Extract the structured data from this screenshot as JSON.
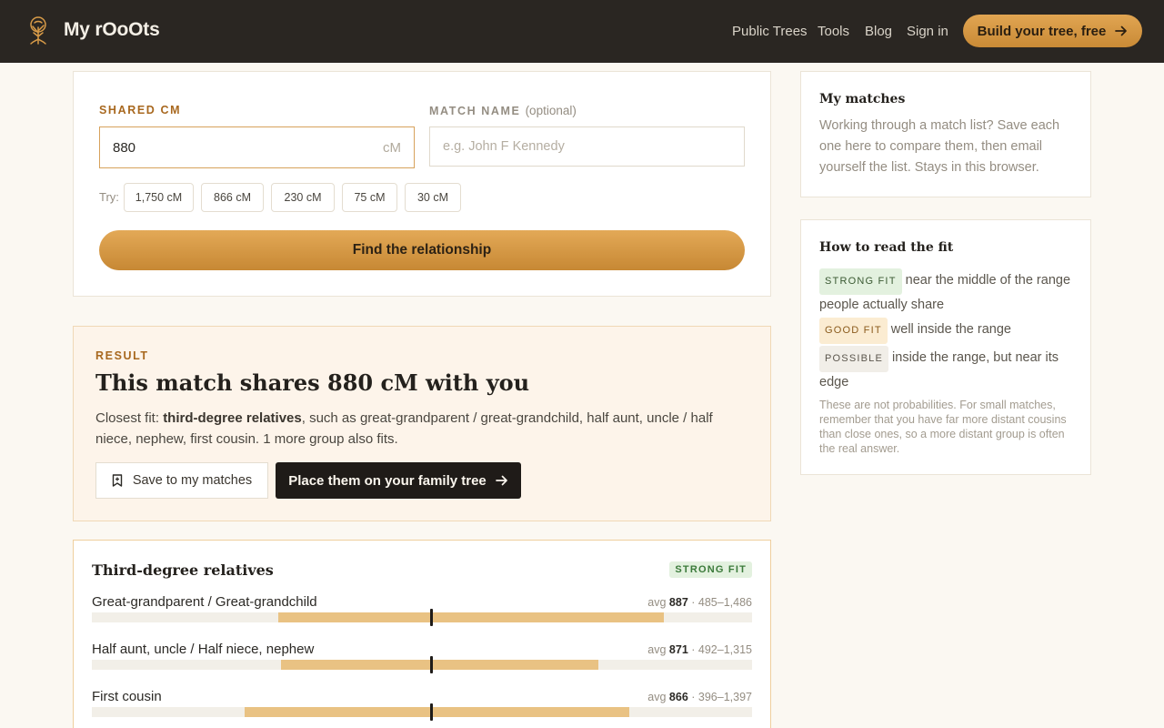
{
  "header": {
    "brand": "My rOoOts",
    "nav": [
      "Public Trees",
      "Tools",
      "Blog",
      "Sign in"
    ],
    "cta": "Build your tree, free"
  },
  "form": {
    "shared_cm_label": "SHARED CM",
    "shared_cm_value": "880",
    "unit": "cM",
    "match_name_label": "MATCH NAME",
    "match_name_optional": "(optional)",
    "match_name_placeholder": "e.g. John F Kennedy",
    "try_label": "Try:",
    "try_chips": [
      "1,750 cM",
      "866 cM",
      "230 cM",
      "75 cM",
      "30 cM"
    ],
    "submit": "Find the relationship"
  },
  "result": {
    "label": "RESULT",
    "headline": "This match shares 880 cM with you",
    "closest_prefix": "Closest fit: ",
    "closest_group": "third-degree relatives",
    "closest_rest": ", such as great-grandparent / great-grandchild, half aunt, uncle / half niece, nephew, first cousin. 1 more group also fits.",
    "save_button": "Save to my matches",
    "place_button": "Place them on your family tree"
  },
  "group": {
    "title": "Third-degree relatives",
    "fit": "STRONG FIT",
    "rows": [
      {
        "name": "Great-grandparent / Great-grandchild",
        "avg_label": "avg",
        "avg": "887",
        "range": "· 485–1,486",
        "min": 485,
        "max": 1486,
        "mean": 887
      },
      {
        "name": "Half aunt, uncle / Half niece, nephew",
        "avg_label": "avg",
        "avg": "871",
        "range": "· 492–1,315",
        "min": 492,
        "max": 1315,
        "mean": 871
      },
      {
        "name": "First cousin",
        "avg_label": "avg",
        "avg": "866",
        "range": "· 396–1,397",
        "min": 396,
        "max": 1397,
        "mean": 866
      }
    ],
    "value": 880
  },
  "sidebar": {
    "matches_title": "My matches",
    "matches_text": "Working through a match list? Save each one here to compare them, then email yourself the list. Stays in this browser.",
    "fit_title": "How to read the fit",
    "strong": "STRONG FIT",
    "strong_text": "near the middle of the range people actually share",
    "good": "GOOD FIT",
    "good_text": "well inside the range",
    "possible": "POSSIBLE",
    "possible_text": "inside the range, but near its edge",
    "note": "These are not probabilities. For small matches, remember that you have far more distant cousins than close ones, so a more distant group is often the real answer."
  },
  "colors": {
    "accent": "#d89b48",
    "header": "#2a2622",
    "strong": "#e3f1df",
    "good": "#fbecd2"
  }
}
